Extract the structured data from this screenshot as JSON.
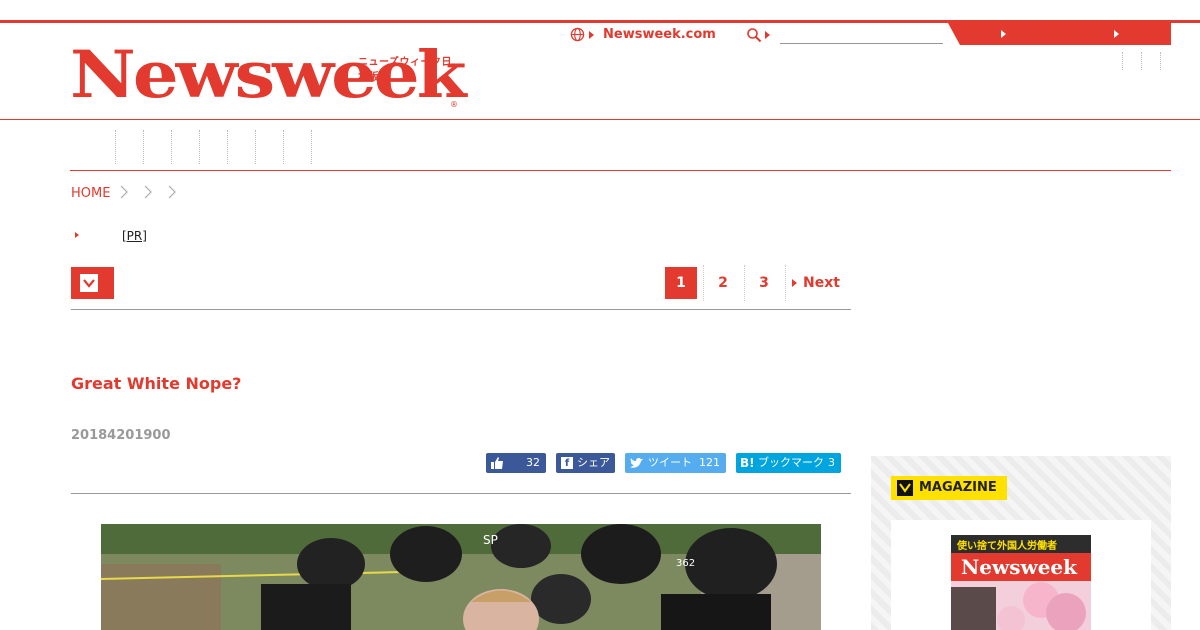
{
  "header": {
    "logo_jp": "ニューズウィーク日本版",
    "logo_word": "Newsweek",
    "site_link": "Newsweek.com",
    "search_placeholder": ""
  },
  "breadcrumb": {
    "home": "HOME"
  },
  "promo_link": "[PR]",
  "pagination": {
    "pages": [
      "1",
      "2",
      "3"
    ],
    "next": "Next",
    "current": "1"
  },
  "article": {
    "title": "Great White Nope?",
    "date": "20184201900"
  },
  "share": {
    "like_count": "32",
    "facebook_label": "シェア",
    "tweet_label": "ツイート",
    "tweet_count": "121",
    "bookmark_label": "ブックマーク",
    "bookmark_count": "3"
  },
  "sidebar": {
    "magazine_label": "MAGAZINE",
    "cover_headline": "使い捨て外国人労働者",
    "cover_logo": "Newsweek"
  },
  "colors": {
    "brand": "#e23a2e",
    "facebook": "#3b5998",
    "twitter": "#55acee",
    "hatena": "#00a4de",
    "magazine_tag": "#ffe100"
  }
}
